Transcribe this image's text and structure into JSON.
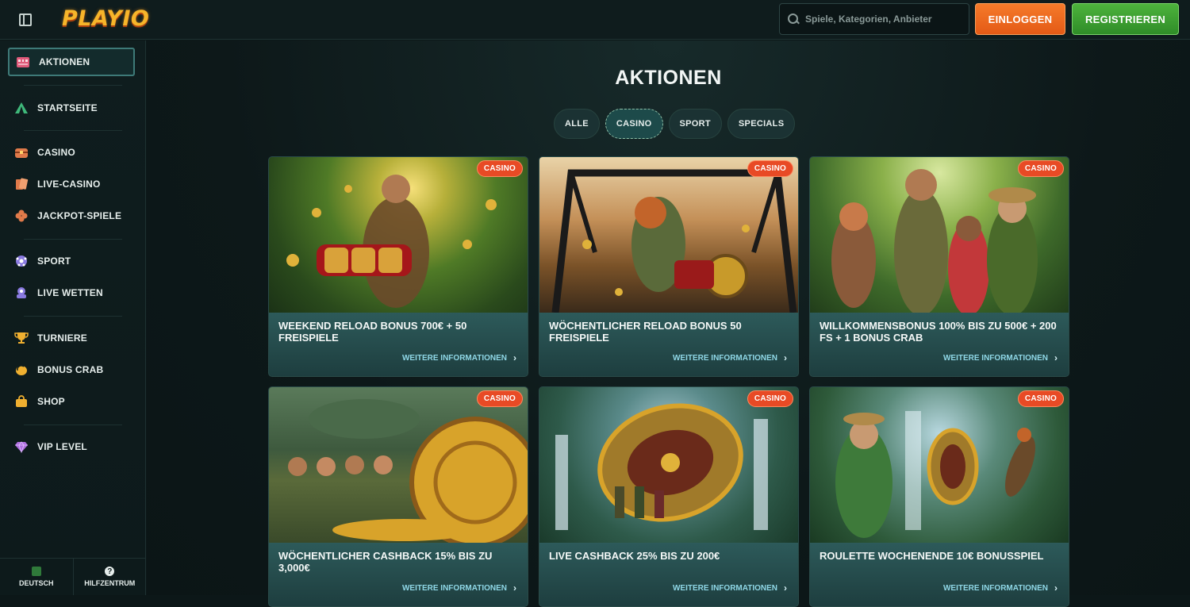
{
  "header": {
    "logo": "PLAYIO",
    "search_placeholder": "Spiele, Kategorien, Anbieter",
    "login_label": "EINLOGGEN",
    "register_label": "REGISTRIEREN"
  },
  "sidebar": {
    "items": [
      {
        "label": "AKTIONEN",
        "icon": "gift-icon"
      },
      {
        "label": "STARTSEITE",
        "icon": "tent-icon"
      },
      {
        "label": "CASINO",
        "icon": "chest-icon"
      },
      {
        "label": "LIVE-CASINO",
        "icon": "cards-icon"
      },
      {
        "label": "JACKPOT-SPIELE",
        "icon": "clover-icon"
      },
      {
        "label": "SPORT",
        "icon": "soccer-ball-icon"
      },
      {
        "label": "LIVE WETTEN",
        "icon": "live-icon"
      },
      {
        "label": "TURNIERE",
        "icon": "trophy-icon"
      },
      {
        "label": "BONUS CRAB",
        "icon": "crab-icon"
      },
      {
        "label": "SHOP",
        "icon": "shopping-bag-icon"
      },
      {
        "label": "VIP LEVEL",
        "icon": "diamond-icon"
      }
    ],
    "bottom": {
      "language_label": "DEUTSCH",
      "help_label": "HILFZENTRUM"
    }
  },
  "main": {
    "title": "AKTIONEN",
    "tabs": [
      {
        "label": "ALLE"
      },
      {
        "label": "CASINO"
      },
      {
        "label": "SPORT"
      },
      {
        "label": "SPECIALS"
      }
    ],
    "cards": [
      {
        "title": "WEEKEND RELOAD BONUS 700€ + 50 FREISPIELE",
        "badge": "CASINO",
        "more": "WEITERE INFORMATIONEN"
      },
      {
        "title": "WÖCHENTLICHER RELOAD BONUS 50 FREISPIELE",
        "badge": "CASINO",
        "more": "WEITERE INFORMATIONEN"
      },
      {
        "title": "WILLKOMMENSBONUS 100% BIS ZU 500€ + 200 FS + 1 BONUS CRAB",
        "badge": "CASINO",
        "more": "WEITERE INFORMATIONEN"
      },
      {
        "title": "WÖCHENTLICHER CASHBACK 15% BIS ZU 3,000€",
        "badge": "CASINO",
        "more": "WEITERE INFORMATIONEN"
      },
      {
        "title": "LIVE CASHBACK 25% BIS ZU 200€",
        "badge": "CASINO",
        "more": "WEITERE INFORMATIONEN"
      },
      {
        "title": "ROULETTE WOCHENENDE 10€ BONUSSPIEL",
        "badge": "CASINO",
        "more": "WEITERE INFORMATIONEN"
      }
    ]
  },
  "colors": {
    "accent_orange": "#e84a25",
    "login_orange": "#f57a2a",
    "register_green": "#4db33c",
    "link_cyan": "#8fd7e6"
  }
}
